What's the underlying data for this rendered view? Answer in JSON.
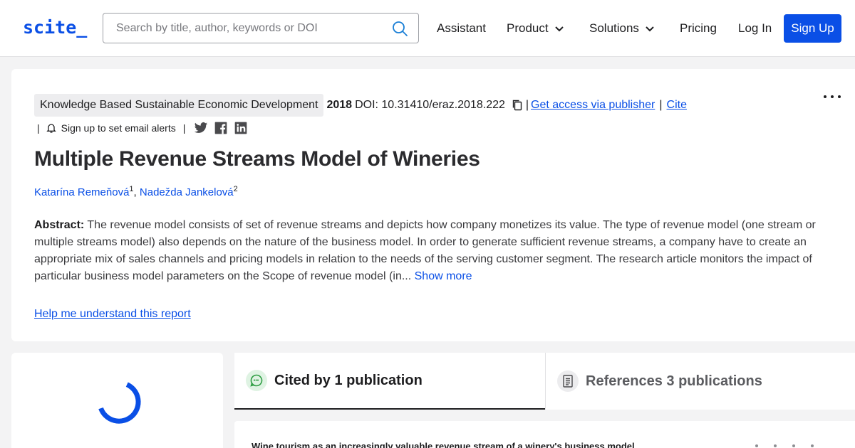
{
  "header": {
    "logo": "scite_",
    "search_placeholder": "Search by title, author, keywords or DOI",
    "search_value": "",
    "nav": {
      "assistant": "Assistant",
      "product": "Product",
      "solutions": "Solutions",
      "pricing": "Pricing",
      "login": "Log In",
      "signup": "Sign Up"
    }
  },
  "paper": {
    "journal": "Knowledge Based Sustainable Economic Development",
    "year": "2018",
    "doi": "DOI: 10.31410/eraz.2018.222",
    "get_access": "Get access via publisher",
    "cite": "Cite",
    "sep": "|",
    "email_alerts": "Sign up to set email alerts",
    "title": "Multiple Revenue Streams Model of Wineries",
    "authors": [
      {
        "name": "Katarína Remeňová",
        "sup": "1"
      },
      {
        "name": "Nadežda Jankelová",
        "sup": "2"
      }
    ],
    "author_separator": ",",
    "abstract_label": "Abstract:",
    "abstract_text": "The revenue model consists of set of revenue streams and depicts how company monetizes its value. The type of revenue model (one stream or multiple streams model) also depends on the nature of the business model. In order to generate sufficient revenue streams, a company have to create an appropriate mix of sales channels and pricing models in relation to the needs of the serving customer segment. The research article monitors the impact of particular business model parameters on the Scope of revenue model (in...",
    "show_more": "Show more",
    "help_link": "Help me understand this report"
  },
  "tabs": {
    "cited": "Cited by 1 publication",
    "references": "References 3 publications"
  },
  "results": {
    "first_title": "Wine tourism as an increasingly valuable revenue stream of a winery's business model"
  },
  "colors": {
    "brand": "#0a4fe6",
    "cited_icon": "#2f9e44"
  },
  "icons": {
    "search": "search-icon",
    "chevron": "chevron-down-icon",
    "copy": "copy-icon",
    "bell": "bell-icon",
    "twitter": "twitter-icon",
    "facebook": "facebook-icon",
    "linkedin": "linkedin-icon",
    "more": "more-dots-icon",
    "spinner": "loading-spinner-icon",
    "cited": "quote-bubble-icon",
    "references": "document-icon"
  }
}
